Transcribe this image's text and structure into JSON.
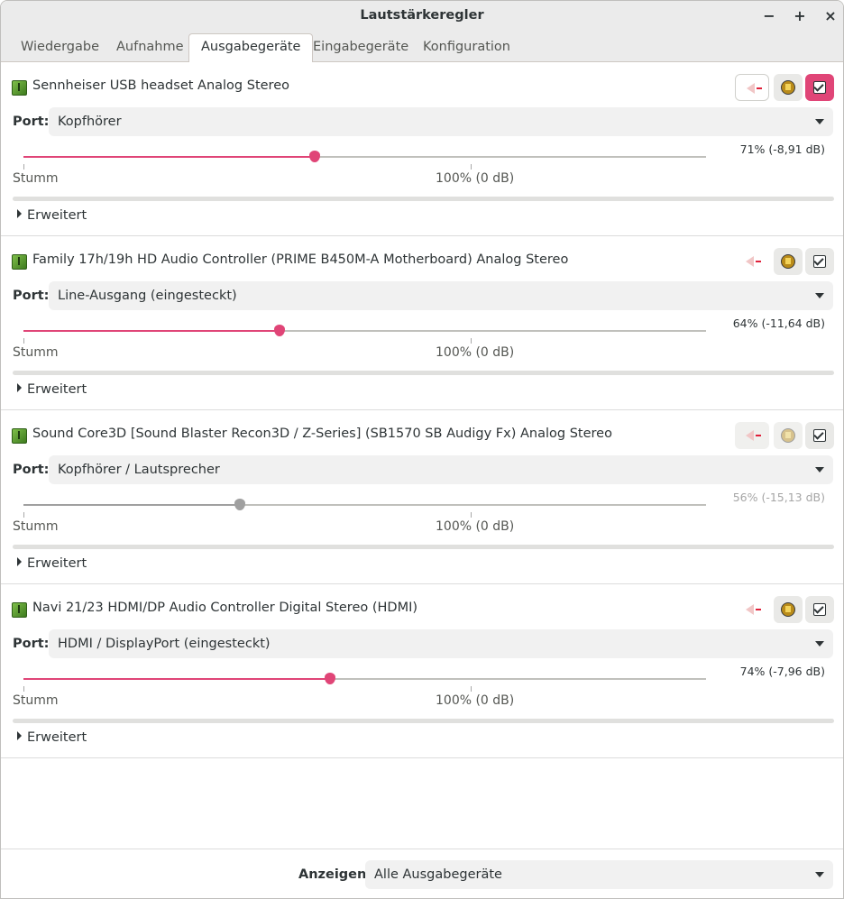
{
  "window": {
    "title": "Lautstärkeregler",
    "controls": [
      "−",
      "+",
      "×"
    ]
  },
  "tabs": [
    {
      "label": "Wiedergabe",
      "active": false
    },
    {
      "label": "Aufnahme",
      "active": false
    },
    {
      "label": "Ausgabegeräte",
      "active": true
    },
    {
      "label": "Eingabegeräte",
      "active": false
    },
    {
      "label": "Konfiguration",
      "active": false
    }
  ],
  "common": {
    "port_label": "Port:",
    "mute_label": "Stumm",
    "hundred_label": "100% (0 dB)",
    "advanced_label": "Erweitert"
  },
  "accent_color": "#e04577",
  "devices": [
    {
      "name": "Sennheiser USB headset Analog Stereo",
      "port": "Kopfhörer",
      "volume_text": "71% (-8,91 dB)",
      "volume_fraction": 0.71,
      "enabled": true,
      "default": true
    },
    {
      "name": "Family 17h/19h HD Audio Controller (PRIME B450M-A Motherboard) Analog Stereo",
      "port": "Line-Ausgang (eingesteckt)",
      "volume_text": "64% (-11,64 dB)",
      "volume_fraction": 0.64,
      "enabled": true,
      "default": false
    },
    {
      "name": "Sound Core3D [Sound Blaster Recon3D / Z-Series] (SB1570 SB Audigy Fx) Analog Stereo",
      "port": "Kopfhörer / Lautsprecher",
      "volume_text": "56% (-15,13 dB)",
      "volume_fraction": 0.56,
      "enabled": false,
      "default": false
    },
    {
      "name": "Navi 21/23 HDMI/DP Audio Controller Digital Stereo (HDMI)",
      "port": "HDMI / DisplayPort (eingesteckt)",
      "volume_text": "74% (-7,96 dB)",
      "volume_fraction": 0.74,
      "enabled": true,
      "default": false
    }
  ],
  "footer": {
    "show_label": "Anzeigen:",
    "show_value": "Alle Ausgabegeräte"
  }
}
